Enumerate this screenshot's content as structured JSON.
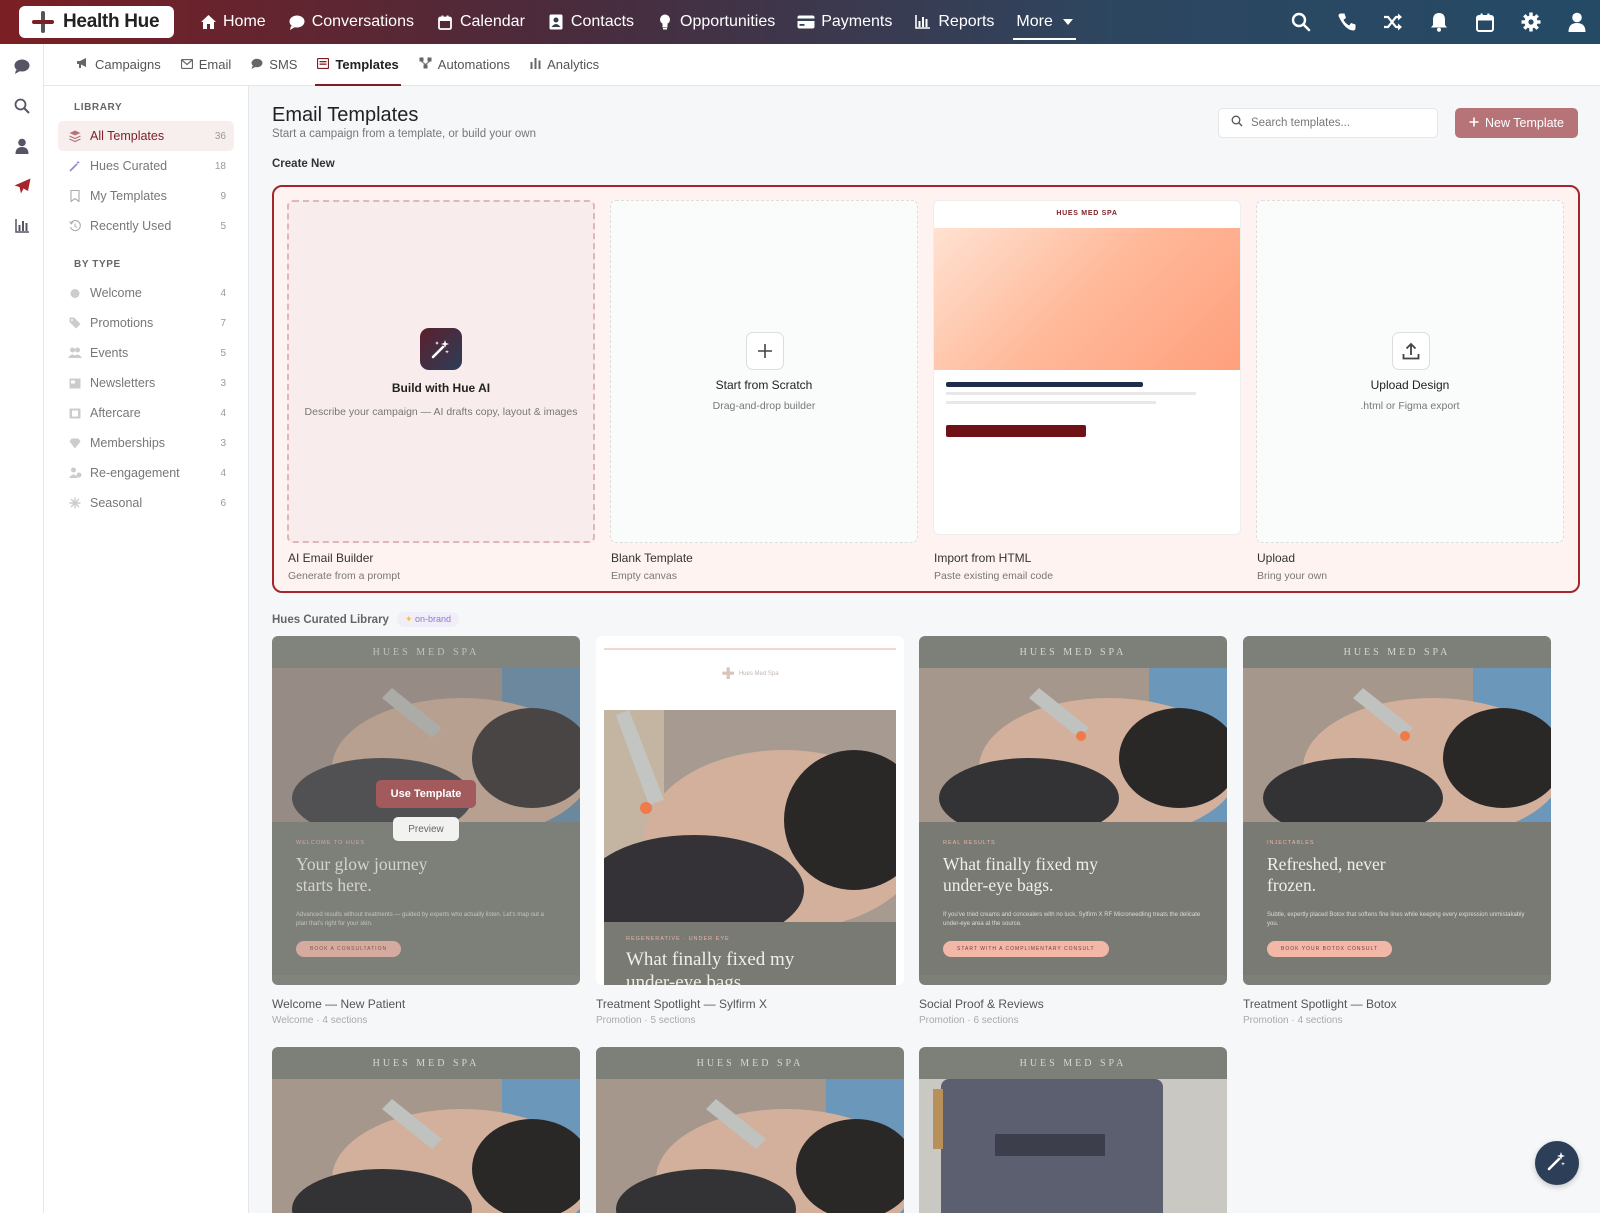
{
  "brand": {
    "name": "Health Hue"
  },
  "nav": {
    "items": [
      {
        "label": "Home",
        "icon": "home-icon"
      },
      {
        "label": "Conversations",
        "icon": "chat-icon"
      },
      {
        "label": "Calendar",
        "icon": "calendar-icon"
      },
      {
        "label": "Contacts",
        "icon": "contact-card-icon"
      },
      {
        "label": "Opportunities",
        "icon": "lightbulb-icon"
      },
      {
        "label": "Payments",
        "icon": "credit-card-icon"
      },
      {
        "label": "Reports",
        "icon": "bar-chart-icon"
      }
    ],
    "more_label": "More",
    "right_icons": [
      "search-icon",
      "phone-icon",
      "shuffle-icon",
      "bell-icon",
      "calendar-icon",
      "gear-icon",
      "user-icon"
    ]
  },
  "rail": {
    "icons": [
      "chat-icon",
      "search-icon",
      "user-icon",
      "send-icon",
      "bar-chart-icon"
    ]
  },
  "subnav": {
    "items": [
      {
        "label": "Campaigns",
        "icon": "megaphone-icon"
      },
      {
        "label": "Email",
        "icon": "envelope-icon"
      },
      {
        "label": "SMS",
        "icon": "chat-icon"
      },
      {
        "label": "Templates",
        "icon": "template-icon",
        "active": true
      },
      {
        "label": "Automations",
        "icon": "workflow-icon"
      },
      {
        "label": "Analytics",
        "icon": "bar-chart-icon"
      }
    ]
  },
  "sidebar": {
    "library_heading": "LIBRARY",
    "library": [
      {
        "label": "All Templates",
        "count": "36",
        "active": true
      },
      {
        "label": "Hues Curated",
        "count": "18"
      },
      {
        "label": "My Templates",
        "count": "9"
      },
      {
        "label": "Recently Used",
        "count": "5"
      }
    ],
    "type_heading": "BY TYPE",
    "types": [
      {
        "label": "Welcome",
        "count": "4"
      },
      {
        "label": "Promotions",
        "count": "7"
      },
      {
        "label": "Events",
        "count": "5"
      },
      {
        "label": "Newsletters",
        "count": "3"
      },
      {
        "label": "Aftercare",
        "count": "4"
      },
      {
        "label": "Memberships",
        "count": "3"
      },
      {
        "label": "Re-engagement",
        "count": "4"
      },
      {
        "label": "Seasonal",
        "count": "6"
      }
    ]
  },
  "main": {
    "title": "Email Templates",
    "subtitle": "Start a campaign from a template, or build your own",
    "search_placeholder": "Search templates...",
    "new_button": "New Template",
    "create_label": "Create New",
    "create": [
      {
        "title": "Build with Hue AI",
        "sub": "Describe your campaign — AI drafts copy, layout & images",
        "cap": "AI Email Builder",
        "cap2": "Generate from a prompt"
      },
      {
        "title": "Start from Scratch",
        "sub": "Drag-and-drop builder",
        "cap": "Blank Template",
        "cap2": "Empty canvas"
      },
      {
        "brand": "HUES MED SPA",
        "cap": "Import from HTML",
        "cap2": "Paste existing email code"
      },
      {
        "title": "Upload Design",
        "sub": ".html or Figma export",
        "cap": "Upload",
        "cap2": "Bring your own"
      }
    ],
    "library_label": "Hues Curated Library",
    "library_badge": "on-brand",
    "templates": [
      {
        "brand": "HUES MED SPA",
        "eyebrow": "WELCOME TO HUES",
        "headline": "Your glow journey starts here.",
        "body": "Advanced results without treatments — guided by experts who actually listen. Let's map out a plan that's right for your skin.",
        "cta": "BOOK A CONSULTATION",
        "name": "Welcome — New Patient",
        "meta": "Welcome · 4 sections",
        "use": "Use Template",
        "preview": "Preview"
      },
      {
        "logo": "Hues Med Spa",
        "eyebrow": "REGENERATIVE · UNDER EYE",
        "headline": "What finally fixed my under-eye bags.",
        "name": "Treatment Spotlight — Sylfirm X",
        "meta": "Promotion · 5 sections"
      },
      {
        "brand": "HUES MED SPA",
        "eyebrow": "REAL RESULTS",
        "headline": "What finally fixed my under-eye bags.",
        "body": "If you've tried creams and concealers with no luck, Sylfirm X RF Microneedling treats the delicate under-eye area at the source.",
        "cta": "START WITH A COMPLIMENTARY CONSULT",
        "name": "Social Proof & Reviews",
        "meta": "Promotion · 6 sections"
      },
      {
        "brand": "HUES MED SPA",
        "eyebrow": "INJECTABLES",
        "headline": "Refreshed, never frozen.",
        "body": "Subtle, expertly placed Botox that softens fine lines while keeping every expression unmistakably you.",
        "cta": "BOOK YOUR BOTOX CONSULT",
        "name": "Treatment Spotlight — Botox",
        "meta": "Promotion · 4 sections"
      }
    ],
    "row2_brands": [
      "HUES MED SPA",
      "HUES MED SPA",
      "HUES MED SPA"
    ]
  },
  "colors": {
    "accent": "#7b1f24",
    "button": "#b67479",
    "navy": "#2d3e58"
  }
}
